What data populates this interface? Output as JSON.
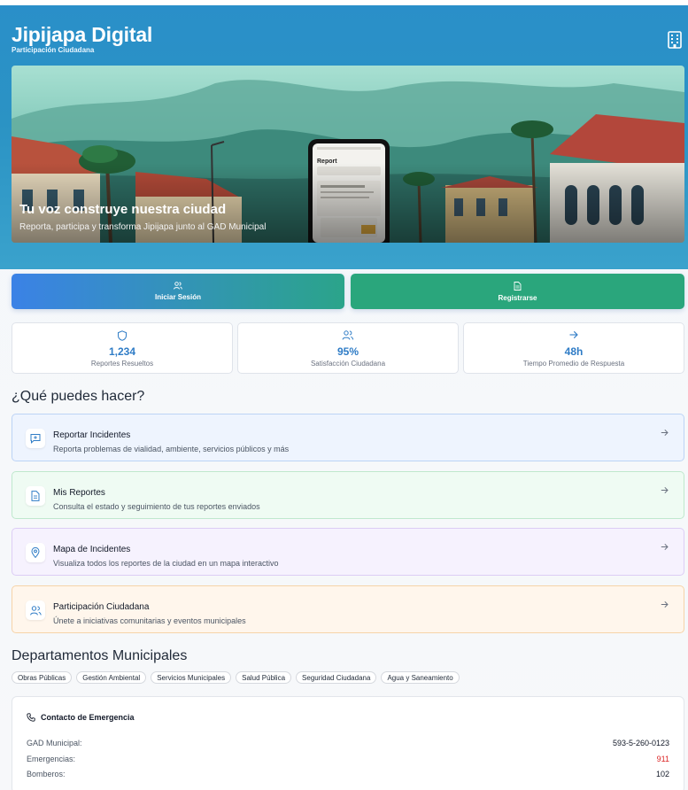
{
  "header": {
    "title": "Jipijapa Digital",
    "subtitle": "Participación Ciudadana",
    "icon": "building-icon"
  },
  "hero": {
    "phone_text": "Report",
    "title": "Tu voz construye nuestra ciudad",
    "text": "Reporta, participa y transforma Jipijapa junto al GAD Municipal"
  },
  "actions": {
    "login_label": "Iniciar Sesión",
    "register_label": "Registrarse"
  },
  "stats": [
    {
      "icon": "shield-icon",
      "value": "1,234",
      "label": "Reportes Resueltos"
    },
    {
      "icon": "users-icon",
      "value": "95%",
      "label": "Satisfacción Ciudadana"
    },
    {
      "icon": "arrow-right-icon",
      "value": "48h",
      "label": "Tiempo Promedio de Respuesta"
    }
  ],
  "features": {
    "heading": "¿Qué puedes hacer?",
    "items": [
      {
        "icon": "message-plus-icon",
        "title": "Reportar Incidentes",
        "description": "Reporta problemas de vialidad, ambiente, servicios públicos y más",
        "bg": "#eef4fe",
        "border": "#bcd3f5"
      },
      {
        "icon": "document-icon",
        "title": "Mis Reportes",
        "description": "Consulta el estado y seguimiento de tus reportes enviados",
        "bg": "#effbf3",
        "border": "#bfe8cd"
      },
      {
        "icon": "map-pin-icon",
        "title": "Mapa de Incidentes",
        "description": "Visualiza todos los reportes de la ciudad en un mapa interactivo",
        "bg": "#f6f2fe",
        "border": "#dccdf5"
      },
      {
        "icon": "users-icon",
        "title": "Participación Ciudadana",
        "description": "Únete a iniciativas comunitarias y eventos municipales",
        "bg": "#fff6ec",
        "border": "#f6d3a8"
      }
    ]
  },
  "departments": {
    "heading": "Departamentos Municipales",
    "items": [
      "Obras Públicas",
      "Gestión Ambiental",
      "Servicios Municipales",
      "Salud Pública",
      "Seguridad Ciudadana",
      "Agua y Saneamiento"
    ]
  },
  "emergency": {
    "title": "Contacto de Emergencia",
    "icon": "phone-icon",
    "rows": [
      {
        "label": "GAD Municipal:",
        "number": "593-5-260-0123"
      },
      {
        "label": "Emergencias:",
        "number": "911"
      },
      {
        "label": "Bomberos:",
        "number": "102"
      }
    ]
  },
  "colors": {
    "header": "#2b93c4",
    "accent_blue": "#2f7cc6",
    "register_green": "#2aa67c",
    "emergency_red": "#dc2626"
  }
}
